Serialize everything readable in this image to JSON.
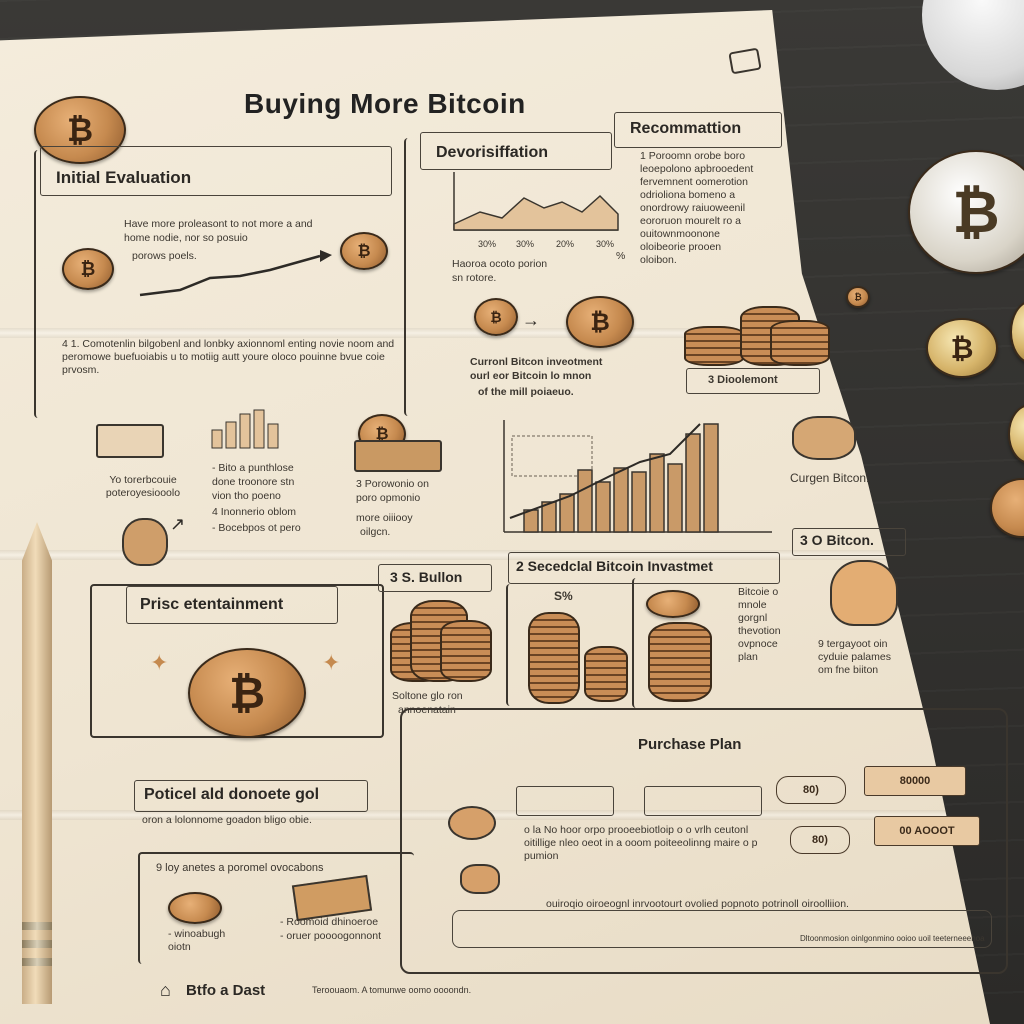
{
  "title": "Buying More Bitcoin",
  "coin_symbol": "₿",
  "sections": {
    "initial_evaluation": {
      "heading": "Initial Evaluation",
      "line1": "Have more proleasont to not more a and",
      "line2": "home nodie, nor so posuio",
      "line3": "porows poels.",
      "para": "4 1. Comotenlin bilgobenl and lonbky axionnoml enting novie noom and peromowe buefuoiabis u to motiig autt youre oloco pouinne bvue coie prvosm."
    },
    "diversification": {
      "heading": "Devorisiffation",
      "tick_labels": [
        "30%",
        "30%",
        "20%",
        "30%"
      ],
      "side_label": "%",
      "caption1": "Haoroa ocoto porion",
      "caption2": "sn rotore.",
      "caption3": "Curronl Bitcon inveotment",
      "caption4": "ourl eor Bitcoin lo mnon",
      "caption5": "of the mill poiaeuo."
    },
    "recommendation": {
      "heading": "Recommattion",
      "lines": [
        "1 Poroomn orobe boro",
        "leoepolono apbrooedent",
        "fervemnent oomerotion",
        "odrioliona bomeno a",
        "onordrowy raiuoweenil",
        "eororuon mourelt ro a",
        "ouitownmoonone",
        "oloibeorie prooen",
        "oloibon."
      ],
      "divestment_label": "3 Dioolemont"
    },
    "icons_row": {
      "col1": "Yo torerbcouie poteroyesiooolo",
      "col2a": "- Bito a punthlose",
      "col2b": "done troonore stn",
      "col2c": "vion tho poeno",
      "col2d": "4 Inonnerio oblom",
      "col2e": "- Bocebpos ot pero",
      "col3a": "3 Porowonio on",
      "col3b": "poro opmonio",
      "col3c": "more oiiiooy",
      "col3d": "oilgcn."
    },
    "current_bitcoin": "Curgen Bitcon.",
    "price_entertainment": {
      "heading": "Prisc etentainment"
    },
    "bullon": {
      "label": "3 S. Bullon",
      "caption1": "Soltone glo ron",
      "caption2": "annoenatain"
    },
    "strategic": {
      "label": "2 Secedclal Bitcoin Invastmet",
      "percent": "S%"
    },
    "bitcoin_box": {
      "label": "3 O Bitcon.",
      "lines": [
        "Bitcoie o",
        "mnole",
        "gorgnl",
        "thevotion",
        "ovpnoce",
        "plan"
      ],
      "hand_caption": [
        "9 tergayoot oin",
        "cyduie palames",
        "om fne biiton"
      ]
    },
    "potential_goal": {
      "heading": "Poticel ald donoete gol",
      "line": "oron a lolonnome goadon bligo obie.",
      "item": "9 loy anetes a poromel ovocabons",
      "caption_left": "- winoabugh oiotn",
      "caption_right1": "- Roomoid dhinoeroe",
      "caption_right2": "- oruer poooogonnont"
    },
    "purchase_plan": {
      "heading": "Purchase Plan",
      "btn1": "80)",
      "btn2": "80000",
      "btn3": "80)",
      "btn4": "00 AOOOT",
      "para": "o la No hoor orpo prooeebiotloip o o vrlh ceutonl oitillige nleo oeot in a ooom poiteeolinng maire o p pumion",
      "footer": "ouiroqio oiroeognl inrvootourt ovolied popnoto potrinoll oiroolliion."
    },
    "footer": {
      "brand": "Btfo a Dast",
      "text": "Teroouaom. A tomunwe oomo oooondn.",
      "right": "Dltoonmosion oinlgonmino ooioo uoil teeterneeenoa"
    }
  }
}
